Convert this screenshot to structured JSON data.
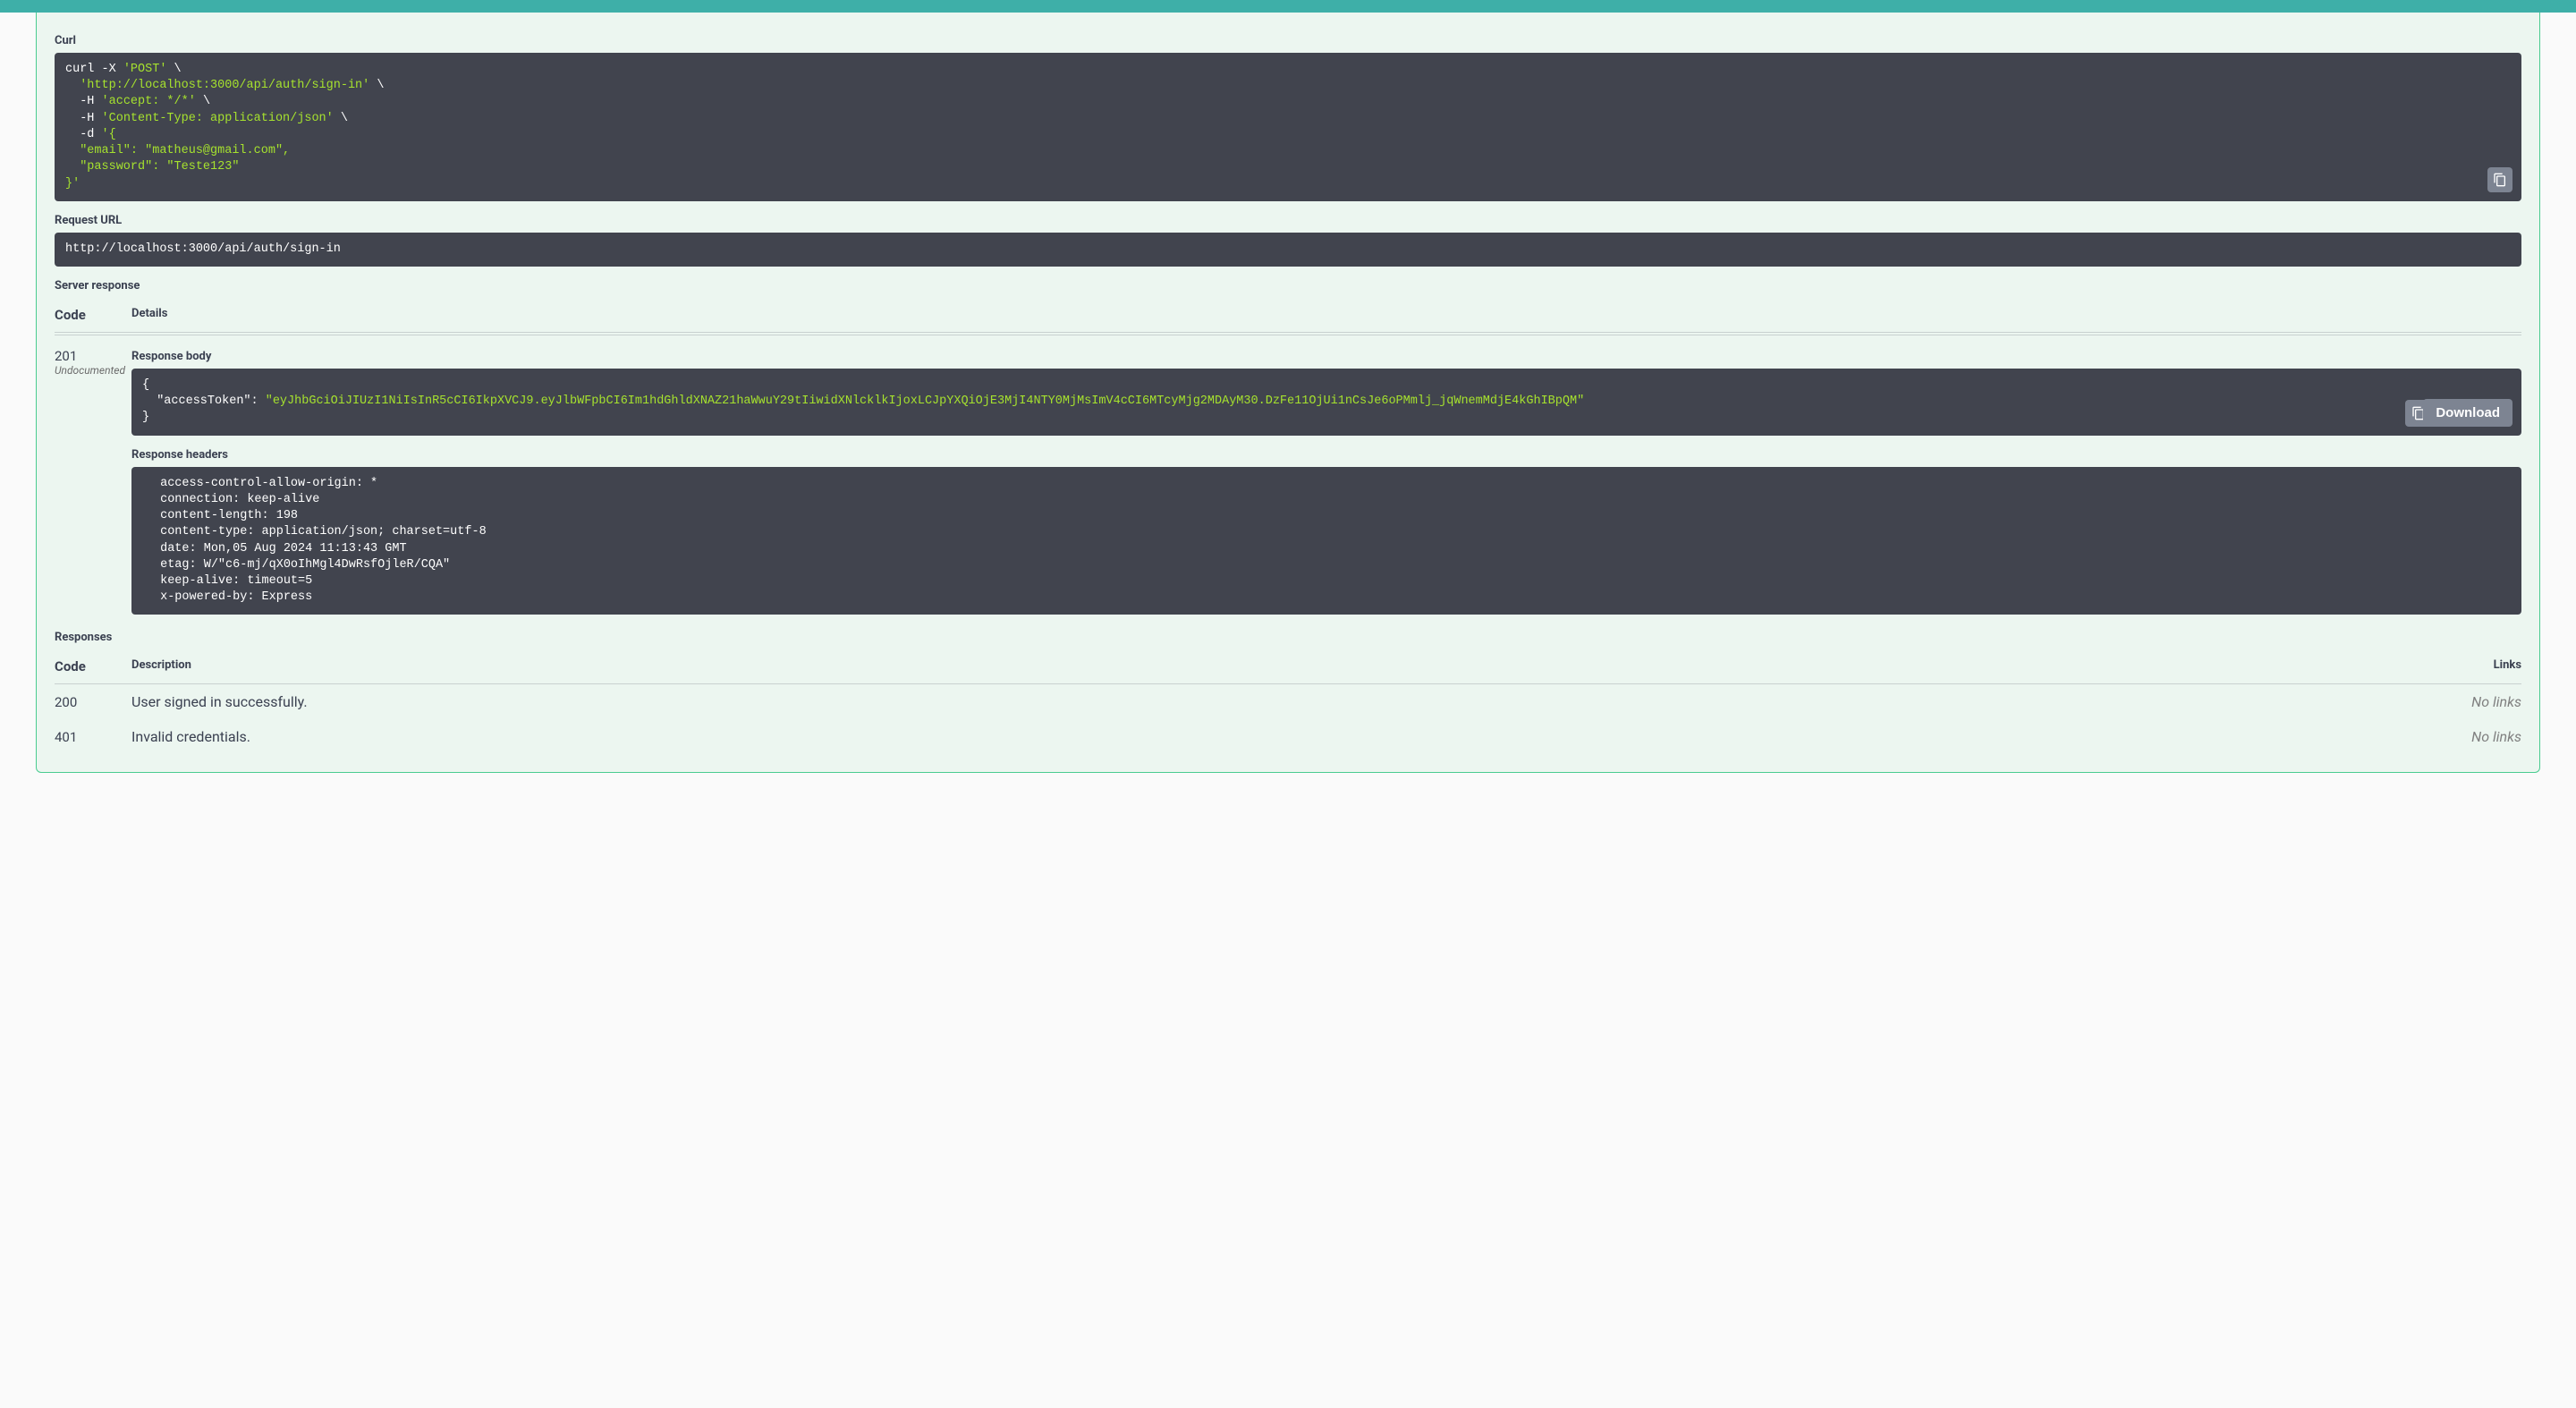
{
  "sections": {
    "curl_label": "Curl",
    "request_url_label": "Request URL",
    "server_response_label": "Server response",
    "responses_label": "Responses",
    "response_body_label": "Response body",
    "response_headers_label": "Response headers"
  },
  "table": {
    "code_header": "Code",
    "details_header": "Details",
    "description_header": "Description",
    "links_header": "Links"
  },
  "curl": {
    "l1a": "curl -X ",
    "l1b": "'POST'",
    "l1c": " \\",
    "l2a": "  ",
    "l2b": "'http://localhost:3000/api/auth/sign-in'",
    "l2c": " \\",
    "l3a": "  -H ",
    "l3b": "'accept: */*'",
    "l3c": " \\",
    "l4a": "  -H ",
    "l4b": "'Content-Type: application/json'",
    "l4c": " \\",
    "l5a": "  -d ",
    "l5b": "'{",
    "l6": "  \"email\": \"matheus@gmail.com\",",
    "l7": "  \"password\": \"Teste123\"",
    "l8": "}'"
  },
  "request_url": "http://localhost:3000/api/auth/sign-in",
  "server_response": {
    "code": "201",
    "undocumented": "Undocumented",
    "body_open": "{",
    "body_key_indent": "  ",
    "body_key": "\"accessToken\"",
    "body_colon": ": ",
    "body_val": "\"eyJhbGciOiJIUzI1NiIsInR5cCI6IkpXVCJ9.eyJlbWFpbCI6Im1hdGhldXNAZ21haWwuY29tIiwidXNlcklkIjoxLCJpYXQiOjE3MjI4NTY0MjMsImV4cCI6MTcyMjg2MDAyM30.DzFe11OjUi1nCsJe6oPMmlj_jqWnemMdjE4kGhIBpQM\"",
    "body_close": "}",
    "headers": " access-control-allow-origin: * \n connection: keep-alive \n content-length: 198 \n content-type: application/json; charset=utf-8 \n date: Mon,05 Aug 2024 11:13:43 GMT \n etag: W/\"c6-mj/qX0oIhMgl4DwRsfOjleR/CQA\" \n keep-alive: timeout=5 \n x-powered-by: Express "
  },
  "buttons": {
    "download": "Download"
  },
  "responses": [
    {
      "code": "200",
      "description": "User signed in successfully.",
      "links": "No links"
    },
    {
      "code": "401",
      "description": "Invalid credentials.",
      "links": "No links"
    }
  ]
}
